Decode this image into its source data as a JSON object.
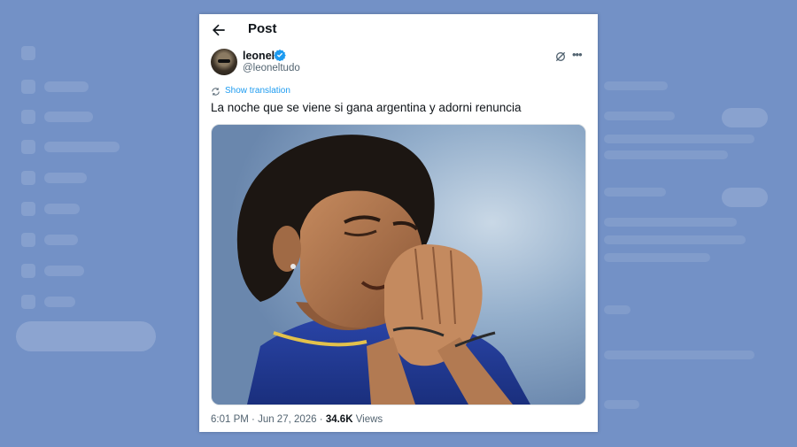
{
  "header": {
    "title": "Post"
  },
  "tweet": {
    "author_name": "leonel",
    "author_handle": "@leoneltudo",
    "show_translation": "Show translation",
    "text": "La noche que se viene si gana argentina y adorni renuncia",
    "time": "6:01 PM",
    "separator": " · ",
    "date": "Jun 27, 2026",
    "views_count": "34.6K",
    "views_label": " Views"
  },
  "icons": {
    "back": "arrow-left-icon",
    "verified": "verified-badge-icon",
    "grok": "grok-icon",
    "more": "more-horizontal-icon",
    "translate": "translate-icon"
  },
  "colors": {
    "accent": "#1d9bf0",
    "text": "#0f1419",
    "secondary": "#536471",
    "backdrop": "#7391c6"
  }
}
